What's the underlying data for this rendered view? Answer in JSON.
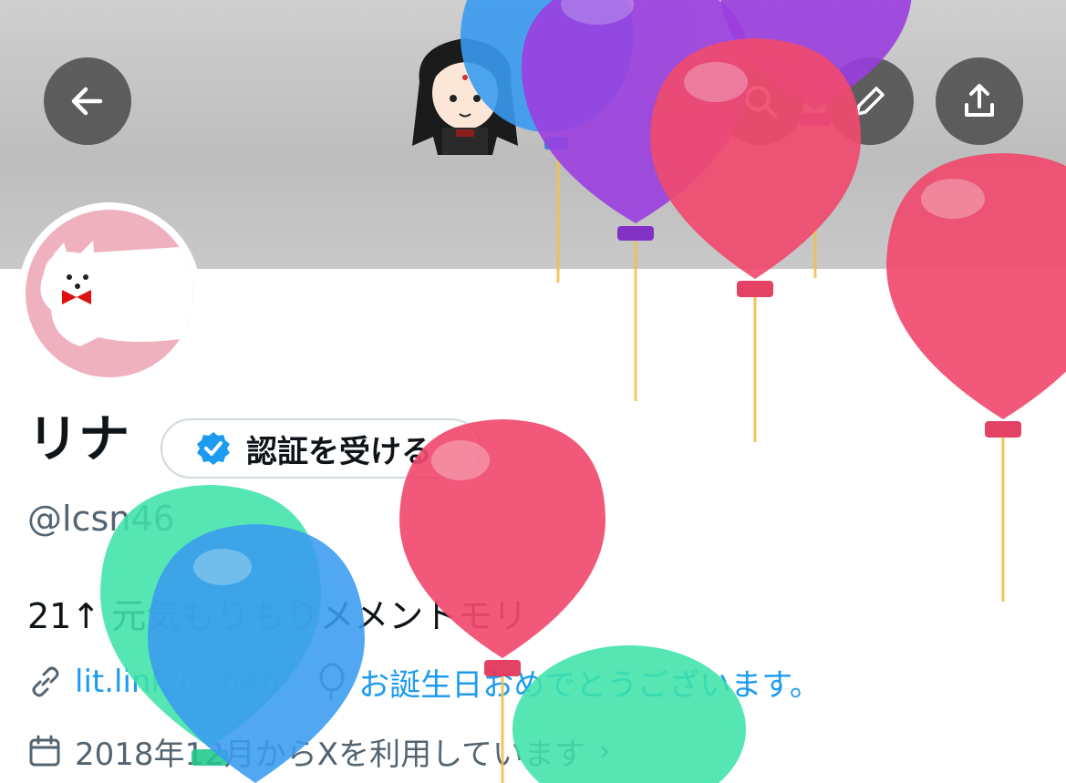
{
  "profile": {
    "name": "リナ",
    "handle": "@lcsn46",
    "bio": "21↑ 元気もりもりメメントモリ",
    "verify_button_label": "認証を受ける",
    "link_text": "lit.link/lcsn46",
    "birthday_text": "お誕生日おめでとうございます。",
    "joined_text": "2018年12月からXを利用しています",
    "joined_chevron": "›"
  },
  "icons": {
    "back": "arrow-left-icon",
    "search": "search-icon",
    "edit": "pencil-icon",
    "share": "share-icon",
    "verified": "verified-badge-icon",
    "link": "link-icon",
    "balloon": "balloon-icon",
    "calendar": "calendar-icon"
  },
  "colors": {
    "accent": "#1d9bf0",
    "text_primary": "#0f1419",
    "text_secondary": "#536471",
    "balloon_red": "#f04a6e",
    "balloon_purple": "#9b3fe0",
    "balloon_blue": "#3a9bf0",
    "balloon_green": "#3ee3a8"
  }
}
